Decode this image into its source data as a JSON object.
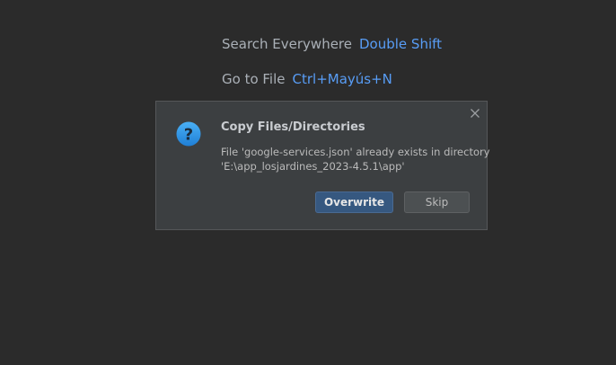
{
  "hints": {
    "search_label": "Search Everywhere",
    "search_shortcut": "Double Shift",
    "goto_label": "Go to File",
    "goto_shortcut": "Ctrl+Mayús+N"
  },
  "dialog": {
    "title": "Copy Files/Directories",
    "message_line1": "File 'google-services.json' already exists in directory",
    "message_line2": "'E:\\app_losjardines_2023-4.5.1\\app'",
    "icon": "question-icon",
    "close_icon": "close-icon",
    "buttons": {
      "overwrite": "Overwrite",
      "skip": "Skip"
    }
  },
  "colors": {
    "background": "#2b2b2b",
    "dialog_bg": "#3c3f41",
    "shortcut": "#589df6",
    "primary_button": "#365880"
  }
}
